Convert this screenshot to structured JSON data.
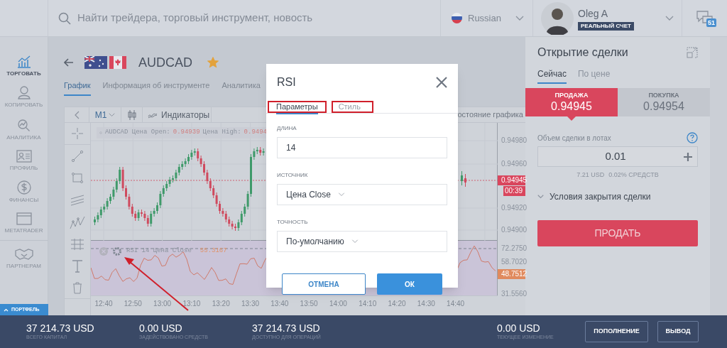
{
  "header": {
    "search": {
      "placeholder": "Найти трейдера, торговый инструмент, новость"
    },
    "language": "Russian",
    "user": {
      "name": "Oleg A",
      "account_badge": "РЕАЛЬНЫЙ СЧЕТ"
    },
    "messages_badge": "51"
  },
  "sidebar": {
    "items": [
      {
        "label": "ТОРГОВАТЬ",
        "selected": true
      },
      {
        "label": "КОПИРОВАТЬ",
        "selected": false
      },
      {
        "label": "АНАЛИТИКА",
        "selected": false
      },
      {
        "label": "ПРОФИЛЬ",
        "selected": false
      },
      {
        "label": "ФИНАНСЫ",
        "selected": false
      },
      {
        "label": "METATRADER",
        "selected": false
      },
      {
        "label": "ПАРТНЕРАМ",
        "selected": false
      }
    ],
    "portfolio_tab": "ПОРТФЕЛЬ"
  },
  "instrument": {
    "symbol": "AUDCAD",
    "favorite": true
  },
  "tabs": [
    {
      "label": "График",
      "selected": true
    },
    {
      "label": "Информация об инструменте",
      "selected": false
    },
    {
      "label": "Аналитика",
      "selected": false
    }
  ],
  "chart_toolbar": {
    "timeframe": "M1",
    "indicators_button": "Индикаторы",
    "state_tab": "остояние графика"
  },
  "chart": {
    "legend": [
      {
        "text": "AUDCAD Цена Open:",
        "kind": "label"
      },
      {
        "text": "0.94939",
        "kind": "value"
      },
      {
        "text": "Цена High:",
        "kind": "label"
      },
      {
        "text": "0.9494",
        "kind": "value"
      }
    ],
    "rsi_legend": {
      "label": "RSI 14 Цена Close",
      "value": "55.3167"
    },
    "price_labels": [
      {
        "text": "0.94980",
        "kind": "tick"
      },
      {
        "text": "0.94960",
        "kind": "tick"
      },
      {
        "text": "0.94945",
        "kind": "price"
      },
      {
        "text": "00:39",
        "kind": "timer"
      },
      {
        "text": "0.94920",
        "kind": "tick"
      },
      {
        "text": "0.94900",
        "kind": "tick"
      },
      {
        "text": "72.2750",
        "kind": "tick"
      },
      {
        "text": "58.7020",
        "kind": "tick"
      },
      {
        "text": "48.7512",
        "kind": "rsi"
      },
      {
        "text": "31.5560",
        "kind": "tick"
      }
    ],
    "time_labels": [
      "12:40",
      "12:50",
      "13:00",
      "13:10",
      "13:20",
      "13:30",
      "13:40",
      "13:50",
      "14:00",
      "14:10",
      "14:20",
      "14:30",
      "14:40"
    ]
  },
  "dialog": {
    "title": "RSI",
    "tabs": [
      {
        "label": "Параметры",
        "selected": true,
        "highlighted": true
      },
      {
        "label": "Стиль",
        "selected": false,
        "highlighted": true
      }
    ],
    "fields": [
      {
        "label": "ДЛИНА",
        "value": "14",
        "kind": "input"
      },
      {
        "label": "ИСТОЧНИК",
        "value": "Цена Close",
        "kind": "select"
      },
      {
        "label": "ТОЧНОСТЬ",
        "value": "По-умолчанию",
        "kind": "select"
      }
    ],
    "buttons": [
      {
        "label": "ОТМЕНА",
        "kind": "secondary"
      },
      {
        "label": "ОК",
        "kind": "primary"
      }
    ]
  },
  "order_panel": {
    "title": "Открытие сделки",
    "tabs": [
      {
        "label": "Сейчас",
        "selected": true
      },
      {
        "label": "По цене",
        "selected": false
      }
    ],
    "sides": [
      {
        "label": "ПРОДАЖА",
        "price": "0.94945",
        "selected": true
      },
      {
        "label": "ПОКУПКА",
        "price": "0.94954",
        "selected": false
      }
    ],
    "volume_label": "Объем сделки в лотах",
    "volume": "0.01",
    "cost": "7.21 USD",
    "share": "0.02% СРЕДСТВ",
    "close_conditions": {
      "label": "Условия закрытия сделки",
      "expanded": false
    },
    "submit": "ПРОДАТЬ"
  },
  "status_bar": {
    "stats": [
      {
        "value": "37 214.73 USD",
        "label": "ВСЕГО КАПИТАЛ"
      },
      {
        "value": "0.00 USD",
        "label": "ЗАДЕЙСТВОВАНО СРЕДСТВ"
      },
      {
        "value": "37 214.73 USD",
        "label": "ДОСТУПНО ДЛЯ ОПЕРАЦИЙ"
      },
      {
        "value": "0.00 USD",
        "label": "ТЕКУЩЕЕ ИЗМЕНЕНИЕ"
      }
    ],
    "buttons": [
      "ПОПОЛНЕНИЕ",
      "ВЫВОД"
    ]
  },
  "annotation_arrow": true
}
